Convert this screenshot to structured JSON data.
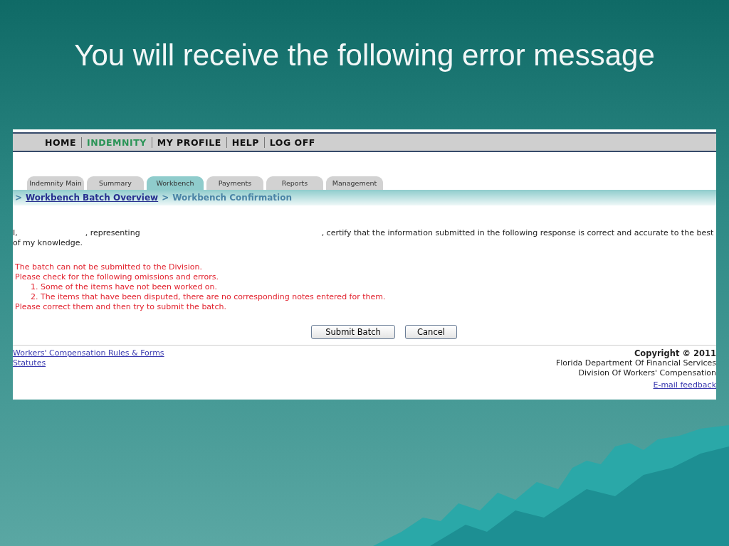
{
  "slide_title": "You will receive the following error message",
  "nav_menu": [
    {
      "label": "HOME",
      "selected": false
    },
    {
      "label": "INDEMNITY",
      "selected": true
    },
    {
      "label": "MY PROFILE",
      "selected": false
    },
    {
      "label": "HELP",
      "selected": false
    },
    {
      "label": "LOG OFF",
      "selected": false
    }
  ],
  "tabs": [
    {
      "label": "Indemnity Main",
      "selected": false
    },
    {
      "label": "Summary",
      "selected": false
    },
    {
      "label": "Workbench",
      "selected": true
    },
    {
      "label": "Payments",
      "selected": false
    },
    {
      "label": "Reports",
      "selected": false
    },
    {
      "label": "Management",
      "selected": false
    }
  ],
  "breadcrumb": [
    {
      "kind": "separator",
      "text": ">"
    },
    {
      "kind": "link",
      "text": "Workbench Batch Overview"
    },
    {
      "kind": "separator",
      "text": ">"
    },
    {
      "kind": "current",
      "text": "Workbench Confirmation"
    }
  ],
  "certification": [
    "I,",
    ", representing",
    ", certify that the information submitted in the following response is correct and accurate to the best of my knowledge."
  ],
  "error_lines": [
    {
      "kind": "line",
      "text": "The batch can not be submitted to the Division."
    },
    {
      "kind": "line",
      "text": "Please check for the following omissions and errors."
    },
    {
      "kind": "item",
      "text": "1. Some of the items have not been worked on."
    },
    {
      "kind": "item",
      "text": "2. The items that have been disputed, there are no corresponding notes entered for them."
    },
    {
      "kind": "line",
      "text": "Please correct them and then try to submit the batch."
    }
  ],
  "buttons": [
    "Submit Batch",
    "Cancel"
  ],
  "footer_links": [
    "Workers' Compensation Rules & Forms",
    "Statutes"
  ],
  "copyright": {
    "title": "Copyright © 2011",
    "lines": [
      "Florida Department Of Financial Services",
      "Division Of Workers' Compensation"
    ],
    "feedback_link": "E-mail feedback"
  }
}
